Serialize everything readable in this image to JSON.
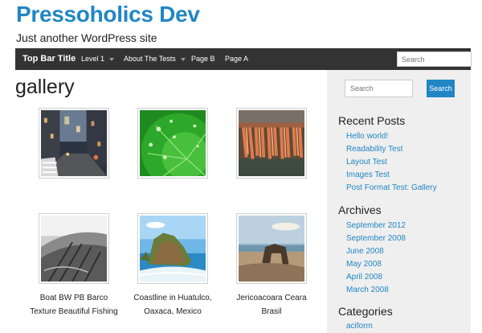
{
  "site": {
    "title": "Pressoholics Dev",
    "description": "Just another WordPress site"
  },
  "topbar": {
    "brand": "Top Bar Title",
    "nav": [
      {
        "label": "Level 1",
        "has_dropdown": true
      },
      {
        "label": "About The Tests",
        "has_dropdown": true
      },
      {
        "label": "Page B",
        "has_dropdown": false
      },
      {
        "label": "Page A",
        "has_dropdown": false
      }
    ],
    "search_placeholder": "Search"
  },
  "page": {
    "title": "gallery"
  },
  "gallery": [
    {
      "caption": "",
      "image": "city-street-night"
    },
    {
      "caption": "",
      "image": "green-leaf-droplets"
    },
    {
      "caption": "",
      "image": "orange-wood-closeup"
    },
    {
      "caption": "Boat BW PB Barco Texture Beautiful Fishing",
      "image": "boat-bw"
    },
    {
      "caption": "Coastline in Huatulco, Oaxaca, Mexico",
      "image": "coastline-rock"
    },
    {
      "caption": "Jericoacoara Ceara Brasil",
      "image": "beach-rock-arch"
    }
  ],
  "sidebar": {
    "search_placeholder": "Search",
    "search_button": "Search",
    "recent_posts_title": "Recent Posts",
    "recent_posts": [
      "Hello world!",
      "Readability Test",
      "Layout Test",
      "Images Test",
      "Post Format Test: Gallery"
    ],
    "archives_title": "Archives",
    "archives": [
      "September 2012",
      "September 2008",
      "June 2008",
      "May 2008",
      "April 2008",
      "March 2008"
    ],
    "categories_title": "Categories",
    "categories": [
      "aciform"
    ]
  },
  "colors": {
    "accent": "#2186c4",
    "topbar_bg": "#333333",
    "sidebar_bg": "#efefef"
  }
}
